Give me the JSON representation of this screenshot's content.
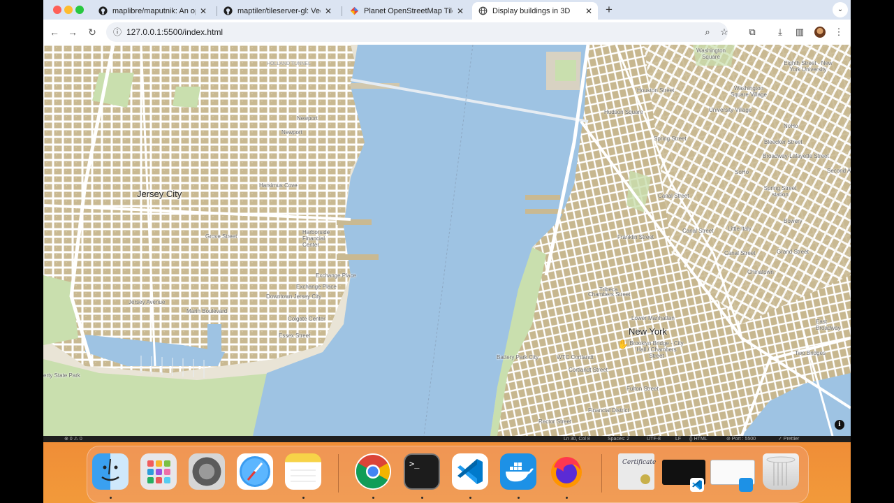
{
  "browser": {
    "tabs": [
      {
        "title": "maplibre/maputnik: An open s",
        "icon": "github-icon",
        "close": "✕"
      },
      {
        "title": "maptiler/tileserver-gl: Vector",
        "icon": "github-icon",
        "close": "✕"
      },
      {
        "title": "Planet OpenStreetMap Tiles, i",
        "icon": "osm-icon",
        "close": "✕"
      },
      {
        "title": "Display buildings in 3D",
        "icon": "globe-icon",
        "close": "✕"
      }
    ],
    "active_tab": 3,
    "new_tab": "+",
    "url": "127.0.0.1:5500/index.html"
  },
  "map": {
    "cities": [
      "Jersey City",
      "New York"
    ],
    "labels": [
      "Newport",
      "Newport",
      "Harsimus Cove",
      "Harborside Financial Center",
      "Grove Street",
      "Exchange Place",
      "Exchange Place",
      "Downtown Jersey City",
      "Colgate Center",
      "Essex Street",
      "Jersey Avenue",
      "Marin Boulevard",
      "erty State Park",
      "Hudson Square",
      "Spring Street",
      "Houston Street",
      "Washington Square",
      "Washington Square Village",
      "University Village",
      "Eighth Street - New York University",
      "NoHo",
      "Bleecker Street",
      "Broadway-Lafayette Street",
      "SoHo",
      "Second Ave",
      "Spring Street station",
      "Canal Street",
      "Canal Street",
      "Canal Street",
      "Little Italy",
      "Bowery",
      "Grand Street",
      "Franklin Street",
      "Chinatown",
      "Tribeca",
      "Chambers Street",
      "Lower Manhattan",
      "East Broadway",
      "Brooklyn Bridge - City Hall / Chambers Street",
      "Two Bridges",
      "Battery Park City",
      "WTC Cortlandt",
      "Cortlandt Street",
      "Fulton Street",
      "Financial District",
      "Rector Street",
      "HOLLAND TUNNEL"
    ],
    "attribution_icon": "info-icon"
  },
  "status_bar": {
    "problems": "⊗ 0 ⚠ 0",
    "position": "Ln 30, Col 8",
    "spaces": "Spaces: 2",
    "encoding": "UTF-8",
    "eol": "LF",
    "language": "{} HTML",
    "port": "⊘ Port : 5500",
    "formatter": "✓ Prettier"
  },
  "dock": {
    "apps": [
      "finder-icon",
      "launchpad-icon",
      "system-settings-icon",
      "safari-icon",
      "notes-icon",
      "chrome-icon",
      "terminal-icon",
      "vscode-icon",
      "docker-icon",
      "firefox-icon",
      "certificate-icon",
      "terminal-window-icon",
      "finder-window-icon",
      "trash-icon"
    ]
  },
  "colors": {
    "water": "#9ec3e3",
    "land": "#e9e4d6",
    "building": "#c9b992",
    "park": "#c9dfae",
    "road": "#ffffff",
    "tabbar": "#dbe4f2"
  }
}
